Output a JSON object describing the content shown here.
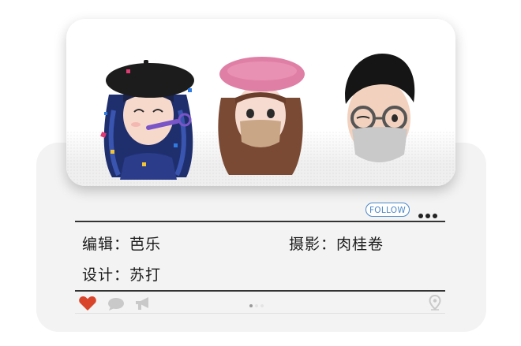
{
  "actions": {
    "follow_label": "FOLLOW",
    "more_icon": "more-dots-icon"
  },
  "credits": {
    "editor": "编辑：芭乐",
    "photo": "摄影：肉桂卷",
    "design": "设计：苏打"
  },
  "toolbar": {
    "icons": [
      "heart-icon",
      "comment-icon",
      "megaphone-icon",
      "location-pin-icon"
    ],
    "heart_color": "#d9452b"
  },
  "pager": {
    "total": 3,
    "active": 1
  },
  "colors": {
    "accent": "#4b87c8",
    "card_bg": "#f3f3f3"
  }
}
